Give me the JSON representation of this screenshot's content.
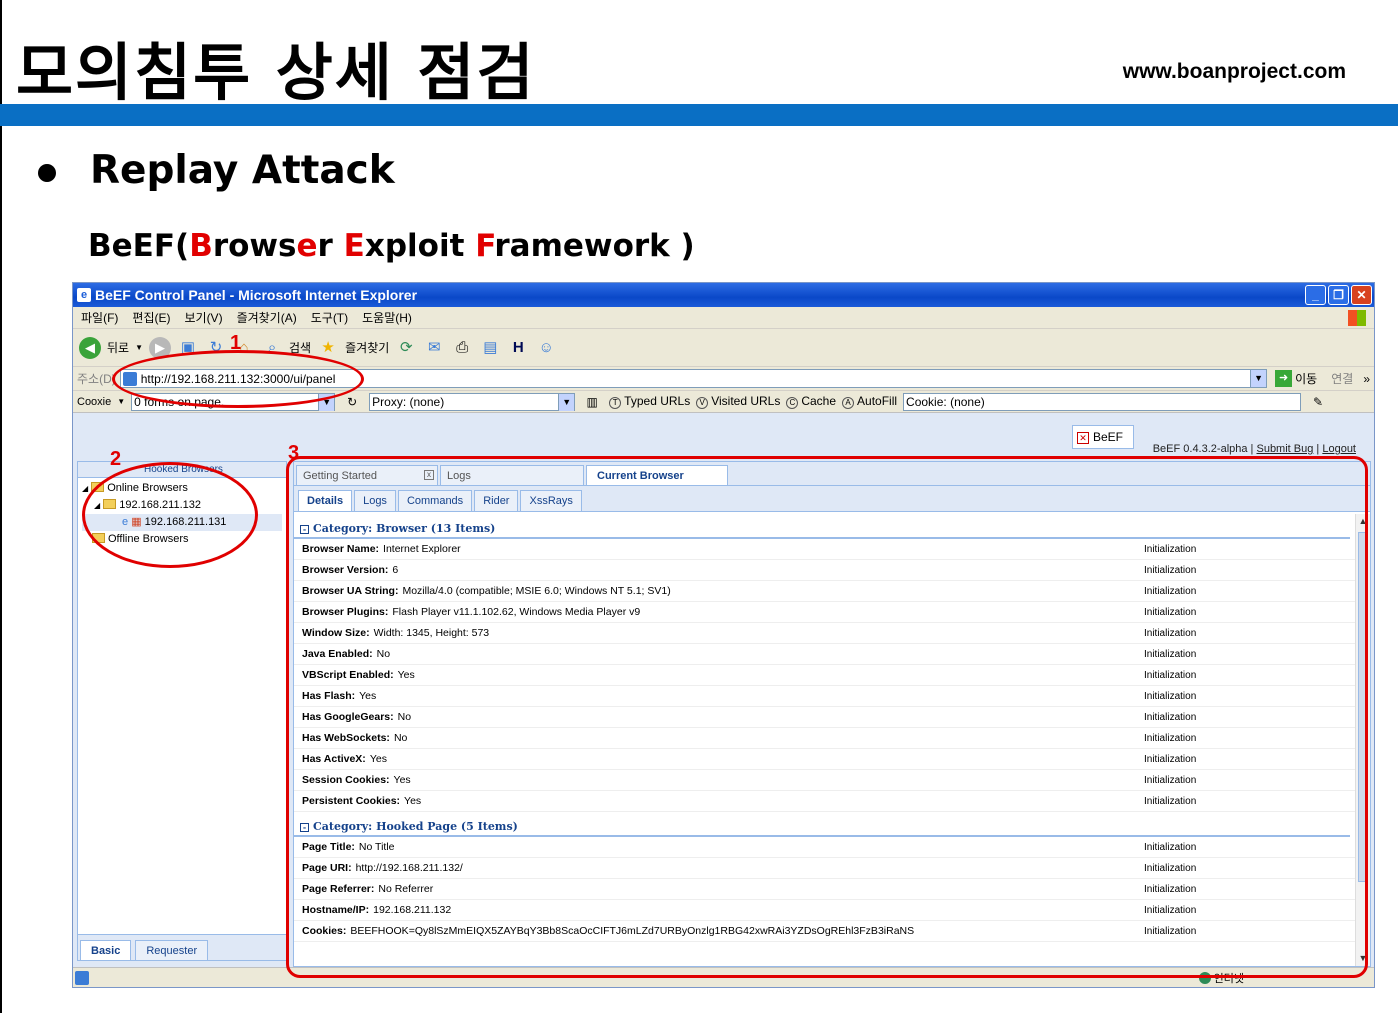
{
  "slide": {
    "title": "모의침투 상세 점검",
    "url": "www.boanproject.com",
    "bullet": "Replay Attack",
    "subtitle_parts": [
      "BeEF(",
      "B",
      "rows",
      "e",
      "r ",
      "E",
      "xploit ",
      "F",
      "ramework )"
    ]
  },
  "window": {
    "title": "BeEF Control Panel - Microsoft Internet Explorer",
    "menu": [
      "파일(F)",
      "편집(E)",
      "보기(V)",
      "즐겨찾기(A)",
      "도구(T)",
      "도움말(H)"
    ],
    "toolbar": {
      "back": "뒤로",
      "search": "검색",
      "favorites": "즐겨찾기"
    },
    "address": {
      "label": "주소(D)",
      "value": "http://192.168.211.132:3000/ui/panel",
      "go": "이동",
      "links": "연결"
    },
    "links_bar": {
      "cookie_label": "Cooxie",
      "forms": "0 forms on page.",
      "proxy": "Proxy: (none)",
      "typed": "Typed URLs",
      "visited": "Visited URLs",
      "cache": "Cache",
      "autofill": "AutoFill",
      "cookie_field": "Cookie: (none)"
    }
  },
  "beef": {
    "badge": "BeEF",
    "version": "BeEF  0.4.3.2-alpha",
    "submit_bug": "Submit  Bug",
    "logout": "Logout",
    "left_panel": {
      "header": "Hooked Browsers",
      "online": "Online Browsers",
      "host": "192.168.211.132",
      "browser": "192.168.211.131",
      "offline": "Offline Browsers",
      "tabs": [
        "Basic",
        "Requester"
      ]
    },
    "tabs": [
      "Getting Started",
      "Logs",
      "Current Browser"
    ],
    "subtabs": [
      "Details",
      "Logs",
      "Commands",
      "Rider",
      "XssRays"
    ],
    "categories": [
      {
        "title": "Category: Browser (13 Items)",
        "rows": [
          {
            "k": "Browser Name:",
            "v": "Internet Explorer",
            "s": "Initialization"
          },
          {
            "k": "Browser Version:",
            "v": "6",
            "s": "Initialization"
          },
          {
            "k": "Browser UA String:",
            "v": "Mozilla/4.0 (compatible; MSIE 6.0; Windows NT 5.1; SV1)",
            "s": "Initialization"
          },
          {
            "k": "Browser Plugins:",
            "v": "Flash Player v11.1.102.62, Windows Media Player v9",
            "s": "Initialization"
          },
          {
            "k": "Window Size:",
            "v": "Width: 1345, Height: 573",
            "s": "Initialization"
          },
          {
            "k": "Java Enabled:",
            "v": "No",
            "s": "Initialization"
          },
          {
            "k": "VBScript Enabled:",
            "v": "Yes",
            "s": "Initialization"
          },
          {
            "k": "Has Flash:",
            "v": "Yes",
            "s": "Initialization"
          },
          {
            "k": "Has GoogleGears:",
            "v": "No",
            "s": "Initialization"
          },
          {
            "k": "Has WebSockets:",
            "v": "No",
            "s": "Initialization"
          },
          {
            "k": "Has ActiveX:",
            "v": "Yes",
            "s": "Initialization"
          },
          {
            "k": "Session Cookies:",
            "v": "Yes",
            "s": "Initialization"
          },
          {
            "k": "Persistent Cookies:",
            "v": "Yes",
            "s": "Initialization"
          }
        ]
      },
      {
        "title": "Category: Hooked Page (5 Items)",
        "rows": [
          {
            "k": "Page Title:",
            "v": "No Title",
            "s": "Initialization"
          },
          {
            "k": "Page URI:",
            "v": "http://192.168.211.132/",
            "s": "Initialization"
          },
          {
            "k": "Page Referrer:",
            "v": "No Referrer",
            "s": "Initialization"
          },
          {
            "k": "Hostname/IP:",
            "v": "192.168.211.132",
            "s": "Initialization"
          },
          {
            "k": "Cookies:",
            "v": "BEEFHOOK=Qy8lSzMmEIQX5ZAYBqY3Bb8ScaOcCIFTJ6mLZd7URByOnzlg1RBG42xwRAi3YZDsOgREhl3FzB3iRaNS",
            "s": "Initialization"
          }
        ]
      }
    ],
    "status_zone": "인터넷"
  },
  "annotations": [
    "1",
    "2",
    "3"
  ],
  "colors": {
    "accent_band": "#0a6fc4",
    "highlight_red": "#e00000",
    "extjs_blue": "#15428b"
  }
}
